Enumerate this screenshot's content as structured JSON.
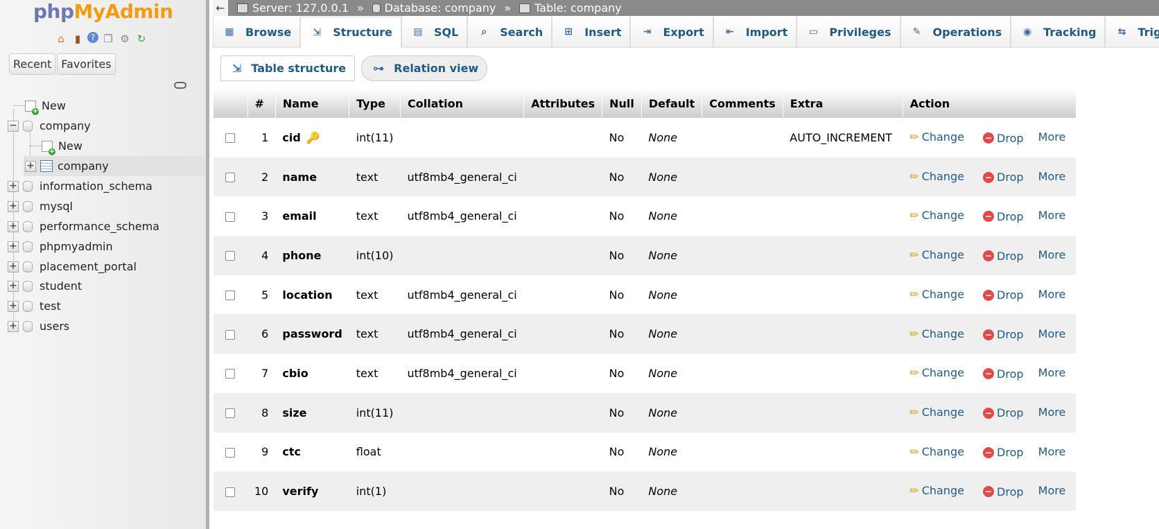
{
  "logo": {
    "php": "php",
    "myadmin": "MyAdmin"
  },
  "sidebar": {
    "quick_icons": [
      "home-icon",
      "logout-icon",
      "help-icon",
      "docs-icon",
      "settings-icon",
      "reload-icon"
    ],
    "tabs": [
      "Recent",
      "Favorites"
    ],
    "tree": [
      {
        "label": "New",
        "kind": "new"
      },
      {
        "label": "company",
        "kind": "db"
      },
      {
        "label": "New",
        "kind": "new"
      },
      {
        "label": "company",
        "kind": "table"
      },
      {
        "label": "information_schema",
        "kind": "db"
      },
      {
        "label": "mysql",
        "kind": "db"
      },
      {
        "label": "performance_schema",
        "kind": "db"
      },
      {
        "label": "phpmyadmin",
        "kind": "db"
      },
      {
        "label": "placement_portal",
        "kind": "db"
      },
      {
        "label": "student",
        "kind": "db"
      },
      {
        "label": "test",
        "kind": "db"
      },
      {
        "label": "users",
        "kind": "db"
      }
    ]
  },
  "breadcrumb": {
    "server": "Server: 127.0.0.1",
    "database": "Database: company",
    "table": "Table: company",
    "sep": "»"
  },
  "tabs": [
    "Browse",
    "Structure",
    "SQL",
    "Search",
    "Insert",
    "Export",
    "Import",
    "Privileges",
    "Operations",
    "Tracking",
    "Triggers"
  ],
  "active_tab": "Structure",
  "subtabs": [
    "Table structure",
    "Relation view"
  ],
  "table": {
    "headers": [
      "#",
      "Name",
      "Type",
      "Collation",
      "Attributes",
      "Null",
      "Default",
      "Comments",
      "Extra",
      "Action"
    ],
    "rows": [
      {
        "n": "1",
        "name": "cid",
        "type": "int(11)",
        "collation": "",
        "null": "No",
        "default": "None",
        "extra": "AUTO_INCREMENT",
        "primary": true
      },
      {
        "n": "2",
        "name": "name",
        "type": "text",
        "collation": "utf8mb4_general_ci",
        "null": "No",
        "default": "None",
        "extra": ""
      },
      {
        "n": "3",
        "name": "email",
        "type": "text",
        "collation": "utf8mb4_general_ci",
        "null": "No",
        "default": "None",
        "extra": ""
      },
      {
        "n": "4",
        "name": "phone",
        "type": "int(10)",
        "collation": "",
        "null": "No",
        "default": "None",
        "extra": ""
      },
      {
        "n": "5",
        "name": "location",
        "type": "text",
        "collation": "utf8mb4_general_ci",
        "null": "No",
        "default": "None",
        "extra": ""
      },
      {
        "n": "6",
        "name": "password",
        "type": "text",
        "collation": "utf8mb4_general_ci",
        "null": "No",
        "default": "None",
        "extra": ""
      },
      {
        "n": "7",
        "name": "cbio",
        "type": "text",
        "collation": "utf8mb4_general_ci",
        "null": "No",
        "default": "None",
        "extra": ""
      },
      {
        "n": "8",
        "name": "size",
        "type": "int(11)",
        "collation": "",
        "null": "No",
        "default": "None",
        "extra": ""
      },
      {
        "n": "9",
        "name": "ctc",
        "type": "float",
        "collation": "",
        "null": "No",
        "default": "None",
        "extra": ""
      },
      {
        "n": "10",
        "name": "verify",
        "type": "int(1)",
        "collation": "",
        "null": "No",
        "default": "None",
        "extra": ""
      }
    ],
    "actions": {
      "change": "Change",
      "drop": "Drop",
      "more": "More"
    }
  }
}
